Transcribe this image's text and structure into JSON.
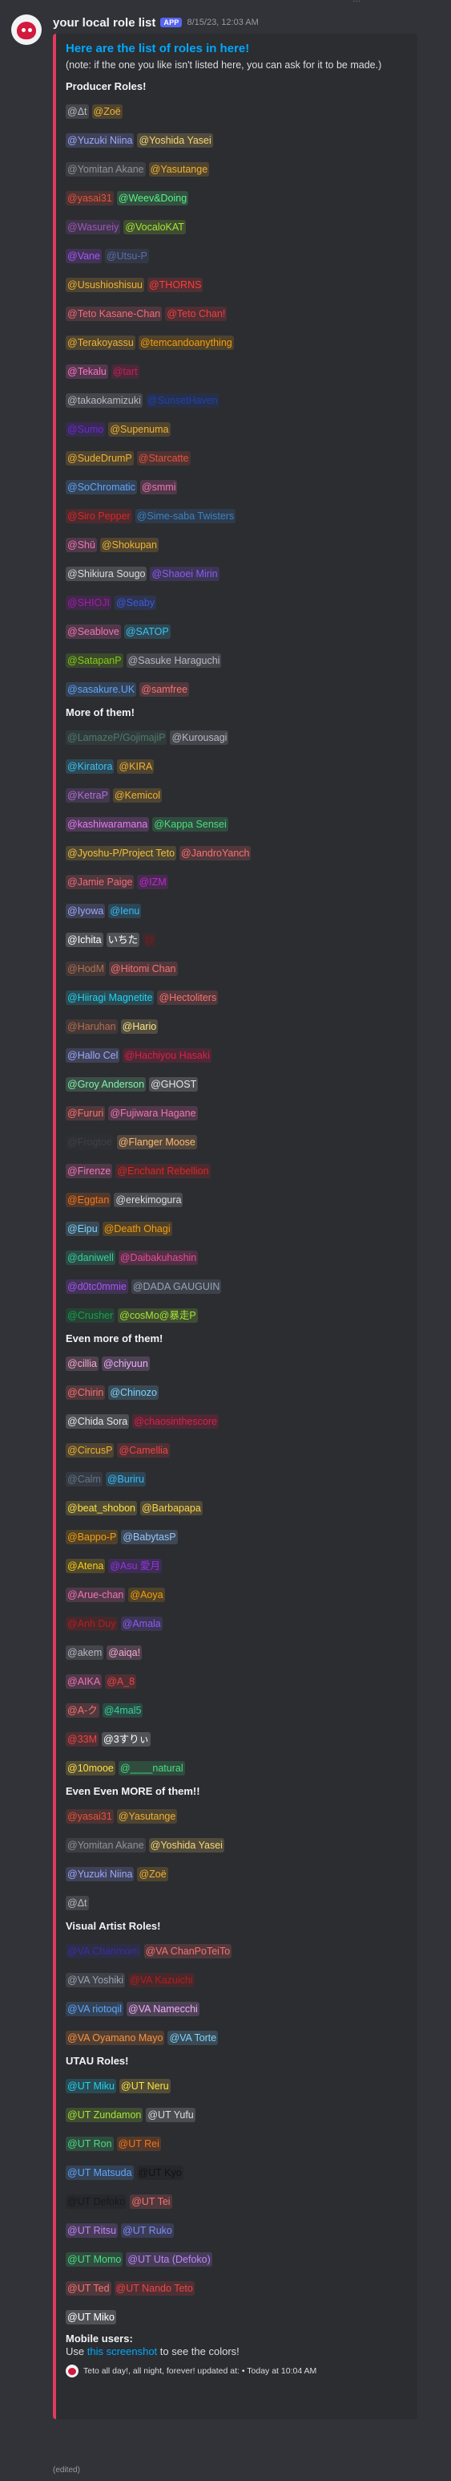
{
  "top_cut_text": "…",
  "message": {
    "username": "your local role list",
    "badge": "APP",
    "timestamp": "8/15/23, 12:03 AM",
    "edited_label": "(edited)"
  },
  "embed": {
    "title": "Here are the list of roles in here!",
    "note": "(note: if the one you like isn't listed here, you can ask for it to be made.)",
    "accent_color": "#e23a5e",
    "mobile_heading": "Mobile users:",
    "mobile_prefix": "Use ",
    "mobile_link": "this screenshot",
    "mobile_suffix": " to see the colors!",
    "footer": "Teto all day!, all night, forever! updated at: • Today at 10:04 AM"
  },
  "sections": [
    {
      "title": "Producer Roles!",
      "lines": [
        [
          {
            "t": "@Δt",
            "c": "#b5bac1"
          },
          {
            "t": "@Zoë",
            "c": "#f0b232"
          }
        ],
        [
          {
            "t": "@Yuzuki Niina",
            "c": "#9da8ff"
          },
          {
            "t": "@Yoshida Yasei",
            "c": "#f7d774"
          }
        ],
        [
          {
            "t": "@Yomitan Akane",
            "c": "#8e9297"
          },
          {
            "t": "@Yasutange",
            "c": "#f0b232"
          }
        ],
        [
          {
            "t": "@yasai31",
            "c": "#e8533b"
          },
          {
            "t": "@Weev&Doing",
            "c": "#57f287"
          }
        ],
        [
          {
            "t": "@Wasureiy",
            "c": "#9b59b6"
          },
          {
            "t": "@VocaloKAT",
            "c": "#a3e635"
          }
        ],
        [
          {
            "t": "@Vane",
            "c": "#a855f7"
          },
          {
            "t": "@Utsu-P",
            "c": "#5b6ea8"
          }
        ],
        [
          {
            "t": "@Usushioshisuu",
            "c": "#f0b232"
          },
          {
            "t": "@THORNS",
            "c": "#ff3b3b"
          }
        ],
        [
          {
            "t": "@Teto Kasane-Chan",
            "c": "#f06b7a"
          },
          {
            "t": "@Teto Chan!",
            "c": "#f23f42"
          }
        ],
        [
          {
            "t": "@Terakoyassu",
            "c": "#f0b232"
          },
          {
            "t": "@temcandoanything",
            "c": "#f59e0b"
          }
        ],
        [
          {
            "t": "@Tekalu",
            "c": "#ff6ec7"
          },
          {
            "t": "@tart",
            "c": "#c81e5a"
          }
        ],
        [
          {
            "t": "@takaokamizuki",
            "c": "#b5bac1"
          },
          {
            "t": "@SunsetHaven",
            "c": "#1e40af"
          }
        ],
        [
          {
            "t": "@Sumo",
            "c": "#6d28d9"
          },
          {
            "t": "@Supenuma",
            "c": "#f0b232"
          }
        ],
        [
          {
            "t": "@SudeDrumP",
            "c": "#f0b232"
          },
          {
            "t": "@Starcatte",
            "c": "#e8533b"
          }
        ],
        [
          {
            "t": "@SoChromatic",
            "c": "#60a5fa"
          },
          {
            "t": "@smmi",
            "c": "#f472b6"
          }
        ],
        [
          {
            "t": "@Siro Pepper",
            "c": "#dc2626"
          },
          {
            "t": "@Sime-saba Twisters",
            "c": "#3b82c4"
          }
        ],
        [
          {
            "t": "@Shū",
            "c": "#f472b6"
          },
          {
            "t": "@Shokupan",
            "c": "#f0b232"
          }
        ],
        [
          {
            "t": "@Shikiura Sougo",
            "c": "#d9dce0"
          },
          {
            "t": "@Shaoei Mirin",
            "c": "#8b5cf6"
          }
        ],
        [
          {
            "t": "@SHIOJI",
            "c": "#a21caf"
          },
          {
            "t": "@Seaby",
            "c": "#3b5bdb"
          }
        ],
        [
          {
            "t": "@Seablove",
            "c": "#f472b6"
          },
          {
            "t": "@SATOP",
            "c": "#3bc2f0"
          }
        ],
        [
          {
            "t": "@SatapanP",
            "c": "#84cc16"
          },
          {
            "t": "@Sasuke Haraguchi",
            "c": "#b5bac1"
          }
        ],
        [
          {
            "t": "@sasakure.UK",
            "c": "#60a5fa"
          },
          {
            "t": "@samfree",
            "c": "#f87171"
          }
        ]
      ]
    },
    {
      "title": "More of them!",
      "lines": [
        [
          {
            "t": "@LamazeP/GojimajiP",
            "c": "#4f7a6a"
          },
          {
            "t": "@Kurousagi",
            "c": "#b5bac1"
          }
        ],
        [
          {
            "t": "@Kiratora",
            "c": "#3bc2f0"
          },
          {
            "t": "@KIRA",
            "c": "#f0b232"
          }
        ],
        [
          {
            "t": "@KetraP",
            "c": "#b06fd6"
          },
          {
            "t": "@Kemicol",
            "c": "#f0b232"
          }
        ],
        [
          {
            "t": "@kashiwaramana",
            "c": "#e879f9"
          },
          {
            "t": "@Kappa Sensei",
            "c": "#4ade80"
          }
        ],
        [
          {
            "t": "@Jyoshu-P/Project Teto",
            "c": "#f0c040"
          },
          {
            "t": "@JandroYanch",
            "c": "#f87171"
          }
        ],
        [
          {
            "t": "@Jamie Paige",
            "c": "#f06b7a"
          },
          {
            "t": "@IZM",
            "c": "#c026d3"
          }
        ],
        [
          {
            "t": "@Iyowa",
            "c": "#9da8ff"
          },
          {
            "t": "@Ienu",
            "c": "#38bdf8"
          }
        ],
        [
          {
            "t": "@Ichita",
            "c": "#ffffff"
          },
          {
            "t": "いちた",
            "c": "#ffffff"
          },
          {
            "t": "@",
            "c": "#7f1d1d"
          }
        ],
        [
          {
            "t": "@HodM",
            "c": "#b06f54"
          },
          {
            "t": "@Hitomi Chan",
            "c": "#f87171"
          }
        ],
        [
          {
            "t": "@Hiiragi Magnetite",
            "c": "#22d3ee"
          },
          {
            "t": "@Hectoliters",
            "c": "#f87171"
          }
        ],
        [
          {
            "t": "@Haruhan",
            "c": "#b06f54"
          },
          {
            "t": "@Hario",
            "c": "#fde68a"
          }
        ],
        [
          {
            "t": "@Hallo Cel",
            "c": "#9da8ff"
          },
          {
            "t": "@Hachiyou Hasaki",
            "c": "#e11d48"
          }
        ],
        [
          {
            "t": "@Groy Anderson",
            "c": "#86efac"
          },
          {
            "t": "@GHOST",
            "c": "#e5e7eb"
          }
        ],
        [
          {
            "t": "@Fururi",
            "c": "#f87171"
          },
          {
            "t": "@Fujiwara Hagane",
            "c": "#f472b6"
          }
        ],
        [
          {
            "t": "@Frogtoe",
            "c": "#3f3f46"
          },
          {
            "t": "@Flanger Moose",
            "c": "#fdba74"
          }
        ],
        [
          {
            "t": "@Firenze",
            "c": "#f472b6"
          },
          {
            "t": "@Enchant Rebellion",
            "c": "#dc2626"
          }
        ],
        [
          {
            "t": "@Eggtan",
            "c": "#f97316"
          },
          {
            "t": "@erekimogura",
            "c": "#d9dce0"
          }
        ],
        [
          {
            "t": "@Eipu",
            "c": "#7dd3fc"
          },
          {
            "t": "@Death Ohagi",
            "c": "#f59e0b"
          }
        ],
        [
          {
            "t": "@daniwell",
            "c": "#34d399"
          },
          {
            "t": "@Daibakuhashin",
            "c": "#ec4899"
          }
        ],
        [
          {
            "t": "@d0tc0mmie",
            "c": "#a855f7"
          },
          {
            "t": "@DADA GAUGUIN",
            "c": "#94a3b8"
          }
        ],
        [
          {
            "t": "@Crusher",
            "c": "#16a34a"
          },
          {
            "t": "@cosMo@暴走P",
            "c": "#a3e635"
          }
        ]
      ]
    },
    {
      "title": "Even more of them!",
      "lines": [
        [
          {
            "t": "@cillia",
            "c": "#f9a8d4"
          },
          {
            "t": "@chiyuun",
            "c": "#f0abfc"
          }
        ],
        [
          {
            "t": "@Chirin",
            "c": "#f87171"
          },
          {
            "t": "@Chinozo",
            "c": "#7dd3fc"
          }
        ],
        [
          {
            "t": "@Chida Sora",
            "c": "#e5e7eb"
          },
          {
            "t": "@chaosinthescore",
            "c": "#e11d48"
          }
        ],
        [
          {
            "t": "@CircusP",
            "c": "#f0b232"
          },
          {
            "t": "@Camellia",
            "c": "#ef4444"
          }
        ],
        [
          {
            "t": "@Calm",
            "c": "#64748b"
          },
          {
            "t": "@Buriru",
            "c": "#38bdf8"
          }
        ],
        [
          {
            "t": "@beat_shobon",
            "c": "#fde047"
          },
          {
            "t": "@Barbapapa",
            "c": "#fcd34d"
          }
        ],
        [
          {
            "t": "@Bappo-P",
            "c": "#f59e0b"
          },
          {
            "t": "@BabytasP",
            "c": "#93c5fd"
          }
        ],
        [
          {
            "t": "@Atena",
            "c": "#facc15"
          },
          {
            "t": "@Asu 愛月",
            "c": "#9333ea"
          }
        ],
        [
          {
            "t": "@Arue-chan",
            "c": "#f472b6"
          },
          {
            "t": "@Aoya",
            "c": "#f59e0b"
          }
        ],
        [
          {
            "t": "@Anh Duy",
            "c": "#b91c1c"
          },
          {
            "t": "@Amala",
            "c": "#8b5cf6"
          }
        ],
        [
          {
            "t": "@akem",
            "c": "#b5bac1"
          },
          {
            "t": "@aiqa!",
            "c": "#f9a8d4"
          }
        ],
        [
          {
            "t": "@AIKA",
            "c": "#f472b6"
          },
          {
            "t": "@A_8",
            "c": "#ef4444"
          }
        ],
        [
          {
            "t": "@A-ク",
            "c": "#f87171"
          },
          {
            "t": "@4mal5",
            "c": "#34d399"
          }
        ],
        [
          {
            "t": "@33M",
            "c": "#ef4444"
          },
          {
            "t": "@3すりぃ",
            "c": "#ffffff"
          }
        ],
        [
          {
            "t": "@10mooe",
            "c": "#fde047"
          },
          {
            "t": "@____natural",
            "c": "#4ade80"
          }
        ]
      ]
    },
    {
      "title": "Even Even MORE of them!!",
      "lines": [
        [
          {
            "t": "@yasai31",
            "c": "#e8533b"
          },
          {
            "t": "@Yasutange",
            "c": "#f0b232"
          }
        ],
        [
          {
            "t": "@Yomitan Akane",
            "c": "#8e9297"
          },
          {
            "t": "@Yoshida Yasei",
            "c": "#f7d774"
          }
        ],
        [
          {
            "t": "@Yuzuki Niina",
            "c": "#9da8ff"
          },
          {
            "t": "@Zoë",
            "c": "#f0b232"
          }
        ],
        [
          {
            "t": "@Δt",
            "c": "#b5bac1"
          }
        ]
      ]
    },
    {
      "title": "Visual Artist Roles!",
      "lines": [
        [
          {
            "t": "@VA Chanmorri",
            "c": "#3730a3"
          },
          {
            "t": "@VA ChanPoTeiTo",
            "c": "#f87171"
          }
        ],
        [
          {
            "t": "@VA Yoshiki",
            "c": "#9ca3af"
          },
          {
            "t": "@VA Kazuichi",
            "c": "#b91c1c"
          }
        ],
        [
          {
            "t": "@VA riotoqil",
            "c": "#60a5fa"
          },
          {
            "t": "@VA Namecchi",
            "c": "#f0abfc"
          }
        ],
        [
          {
            "t": "@VA Oyamano Mayo",
            "c": "#fb923c"
          },
          {
            "t": "@VA Torte",
            "c": "#7dd3fc"
          }
        ]
      ]
    },
    {
      "title": "UTAU Roles!",
      "lines": [
        [
          {
            "t": "@UT Miku",
            "c": "#22d3ee"
          },
          {
            "t": "@UT Neru",
            "c": "#fde047"
          }
        ],
        [
          {
            "t": "@UT Zundamon",
            "c": "#a3e635"
          },
          {
            "t": "@UT Yufu",
            "c": "#d9dce0"
          }
        ],
        [
          {
            "t": "@UT Ron",
            "c": "#4ade80"
          },
          {
            "t": "@UT Rei",
            "c": "#f97316"
          }
        ],
        [
          {
            "t": "@UT Matsuda",
            "c": "#60a5fa"
          },
          {
            "t": "@UT Kyo",
            "c": "#111111"
          }
        ],
        [
          {
            "t": "@UT Defoko",
            "c": "#18181b"
          },
          {
            "t": "@UT Tei",
            "c": "#f87171"
          }
        ],
        [
          {
            "t": "@UT Ritsu",
            "c": "#c084fc"
          },
          {
            "t": "@UT Ruko",
            "c": "#818cf8"
          }
        ],
        [
          {
            "t": "@UT Momo",
            "c": "#4ade80"
          },
          {
            "t": "@UT Uta (Defoko)",
            "c": "#c084fc"
          }
        ],
        [
          {
            "t": "@UT Ted",
            "c": "#f87171"
          },
          {
            "t": "@UT Nando Teto",
            "c": "#ef4444"
          }
        ],
        [
          {
            "t": "@UT Miko",
            "c": "#ffffff"
          }
        ]
      ]
    }
  ]
}
